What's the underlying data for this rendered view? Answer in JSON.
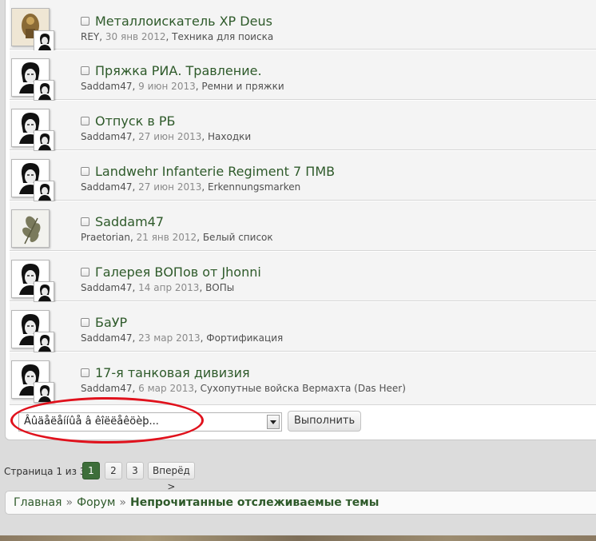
{
  "threads": [
    {
      "title": "Металлоискатель XP Deus",
      "author": "REY",
      "date": "30 янв 2012",
      "forum": "Техника для поиска",
      "avatar_icon": "relic-photo-icon"
    },
    {
      "title": "Пряжка РИА. Травление.",
      "author": "Saddam47",
      "date": "9 июн 2013",
      "forum": "Ремни и пряжки",
      "avatar_icon": "portrait-icon"
    },
    {
      "title": "Отпуск в РБ",
      "author": "Saddam47",
      "date": "27 июн 2013",
      "forum": "Находки",
      "avatar_icon": "portrait-icon"
    },
    {
      "title": "Landwehr Infanterie Regiment 7 ПМВ",
      "author": "Saddam47",
      "date": "27 июн 2013",
      "forum": "Erkennungsmarken",
      "avatar_icon": "portrait-icon"
    },
    {
      "title": "Saddam47",
      "author": "Praetorian",
      "date": "21 янв 2012",
      "forum": "Белый список",
      "avatar_icon": "oak-leaf-icon"
    },
    {
      "title": "Галерея ВОПов от Jhonni",
      "author": "Saddam47",
      "date": "14 апр 2013",
      "forum": "ВОПы",
      "avatar_icon": "portrait-icon"
    },
    {
      "title": "БаУР",
      "author": "Saddam47",
      "date": "23 мар 2013",
      "forum": "Фортификация",
      "avatar_icon": "portrait-icon"
    },
    {
      "title": "17-я танковая дивизия",
      "author": "Saddam47",
      "date": "6 мар 2013",
      "forum": "Сухопутные войска Вермахта (Das Heer)",
      "avatar_icon": "portrait-icon"
    }
  ],
  "sep": ", ",
  "bulk": {
    "select_value": "Âûäåëåííûå â êîëëåêöèþ...",
    "go_label": "Выполнить"
  },
  "pager": {
    "label": "Страница 1 из 3",
    "pages": [
      "1",
      "2",
      "3"
    ],
    "next_label": "Вперёд >",
    "current_page": "1"
  },
  "breadcrumb": {
    "home": "Главная",
    "forum": "Форум",
    "current": "Непрочитанные отслеживаемые темы",
    "separator": "»"
  },
  "colors": {
    "link_green": "#2e5a2a",
    "highlight_red": "#e0111c",
    "current_page_bg": "#3d6e3a"
  }
}
